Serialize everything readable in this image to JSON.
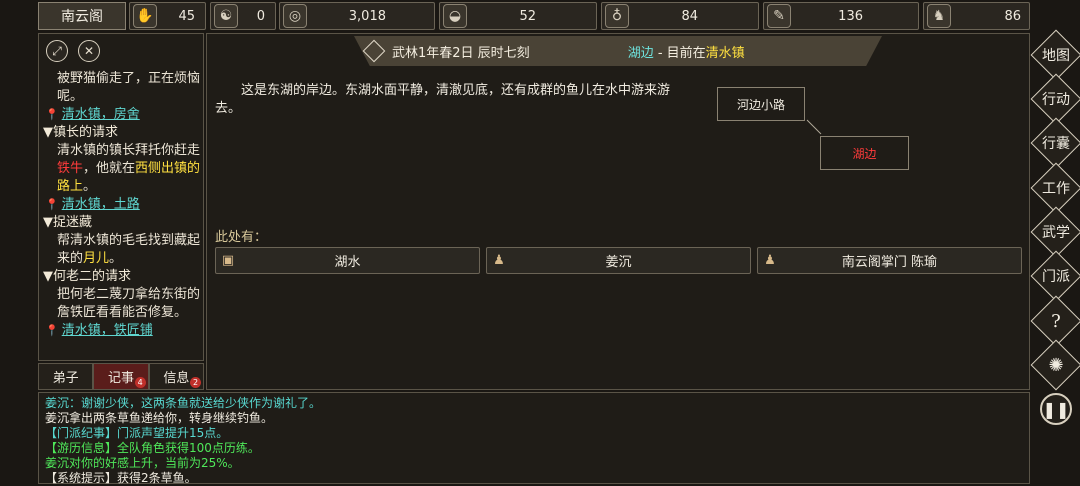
{
  "top_bar": {
    "sect_name": "南云阁",
    "stats": [
      {
        "icon": "hand-icon",
        "glyph": "☯",
        "value": "45"
      },
      {
        "icon": "yinyang-icon",
        "glyph": "☯",
        "value": "0"
      },
      {
        "icon": "coin-icon",
        "glyph": "◎",
        "value": "3,018"
      },
      {
        "icon": "food-bowl-icon",
        "glyph": "◒",
        "value": "52"
      },
      {
        "icon": "gourd-icon",
        "glyph": "♁",
        "value": "84"
      },
      {
        "icon": "scroll-icon",
        "glyph": "✎",
        "value": "136"
      },
      {
        "icon": "horse-icon",
        "glyph": "♞",
        "value": "86"
      }
    ]
  },
  "quests": {
    "q0_tail_text": "被野猫偷走了，正在烦恼呢。",
    "q0_location": "清水镇，房舍",
    "q1_title": "▼镇长的请求",
    "q1_body_a": "清水镇的镇长拜托你赶走",
    "q1_body_red": "铁牛",
    "q1_body_b": "，他就在",
    "q1_body_yellow": "西侧出镇的路上",
    "q1_body_c": "。",
    "q1_location": "清水镇，土路",
    "q2_title": "▼捉迷藏",
    "q2_body_a": "帮清水镇的毛毛找到藏起来的",
    "q2_body_yellow": "月儿",
    "q2_body_b": "。",
    "q3_title": "▼何老二的请求",
    "q3_body": "把何老二蔑刀拿给东街的詹铁匠看看能否修复。",
    "q3_location": "清水镇，铁匠铺"
  },
  "tabs": {
    "disciples": "弟子",
    "events": "记事",
    "events_badge": "4",
    "messages": "信息",
    "messages_badge": "2"
  },
  "main": {
    "date_time": "武林1年春2日 辰时七刻",
    "location_name": "湖边",
    "location_sep": " - 目前在",
    "town_name": "清水镇",
    "description": "这是东湖的岸边。东湖水面平静，清澈见底，还有成群的鱼儿在水中游来游去。",
    "map_nodes": {
      "path": "河边小路",
      "current": "湖边"
    },
    "here_label": "此处有：",
    "entities": [
      {
        "icon": "box-icon",
        "glyph": "▣",
        "name": "湖水"
      },
      {
        "icon": "person-icon",
        "glyph": "♟",
        "name": "姜沉"
      },
      {
        "icon": "person-icon",
        "glyph": "♟",
        "name": "南云阁掌门 陈瑜"
      }
    ]
  },
  "log": [
    {
      "cls": "cyan",
      "text": "姜沉：谢谢少侠，这两条鱼就送给少侠作为谢礼了。"
    },
    {
      "cls": "white",
      "text": "姜沉拿出两条草鱼递给你，转身继续钓鱼。"
    },
    {
      "cls": "cyan",
      "text": "【门派纪事】门派声望提升15点。"
    },
    {
      "cls": "green",
      "text": "【游历信息】全队角色获得100点历练。"
    },
    {
      "cls": "green",
      "text": "姜沉对你的好感上升，当前为25%。"
    },
    {
      "cls": "white",
      "text": "【系统提示】获得2条草鱼。"
    }
  ],
  "right_menu": {
    "map": "地图",
    "action": "行动",
    "bag": "行囊",
    "work": "工作",
    "martial": "武学",
    "sect": "门派",
    "help": "?",
    "settings": "✺",
    "pause": "❚❚"
  }
}
